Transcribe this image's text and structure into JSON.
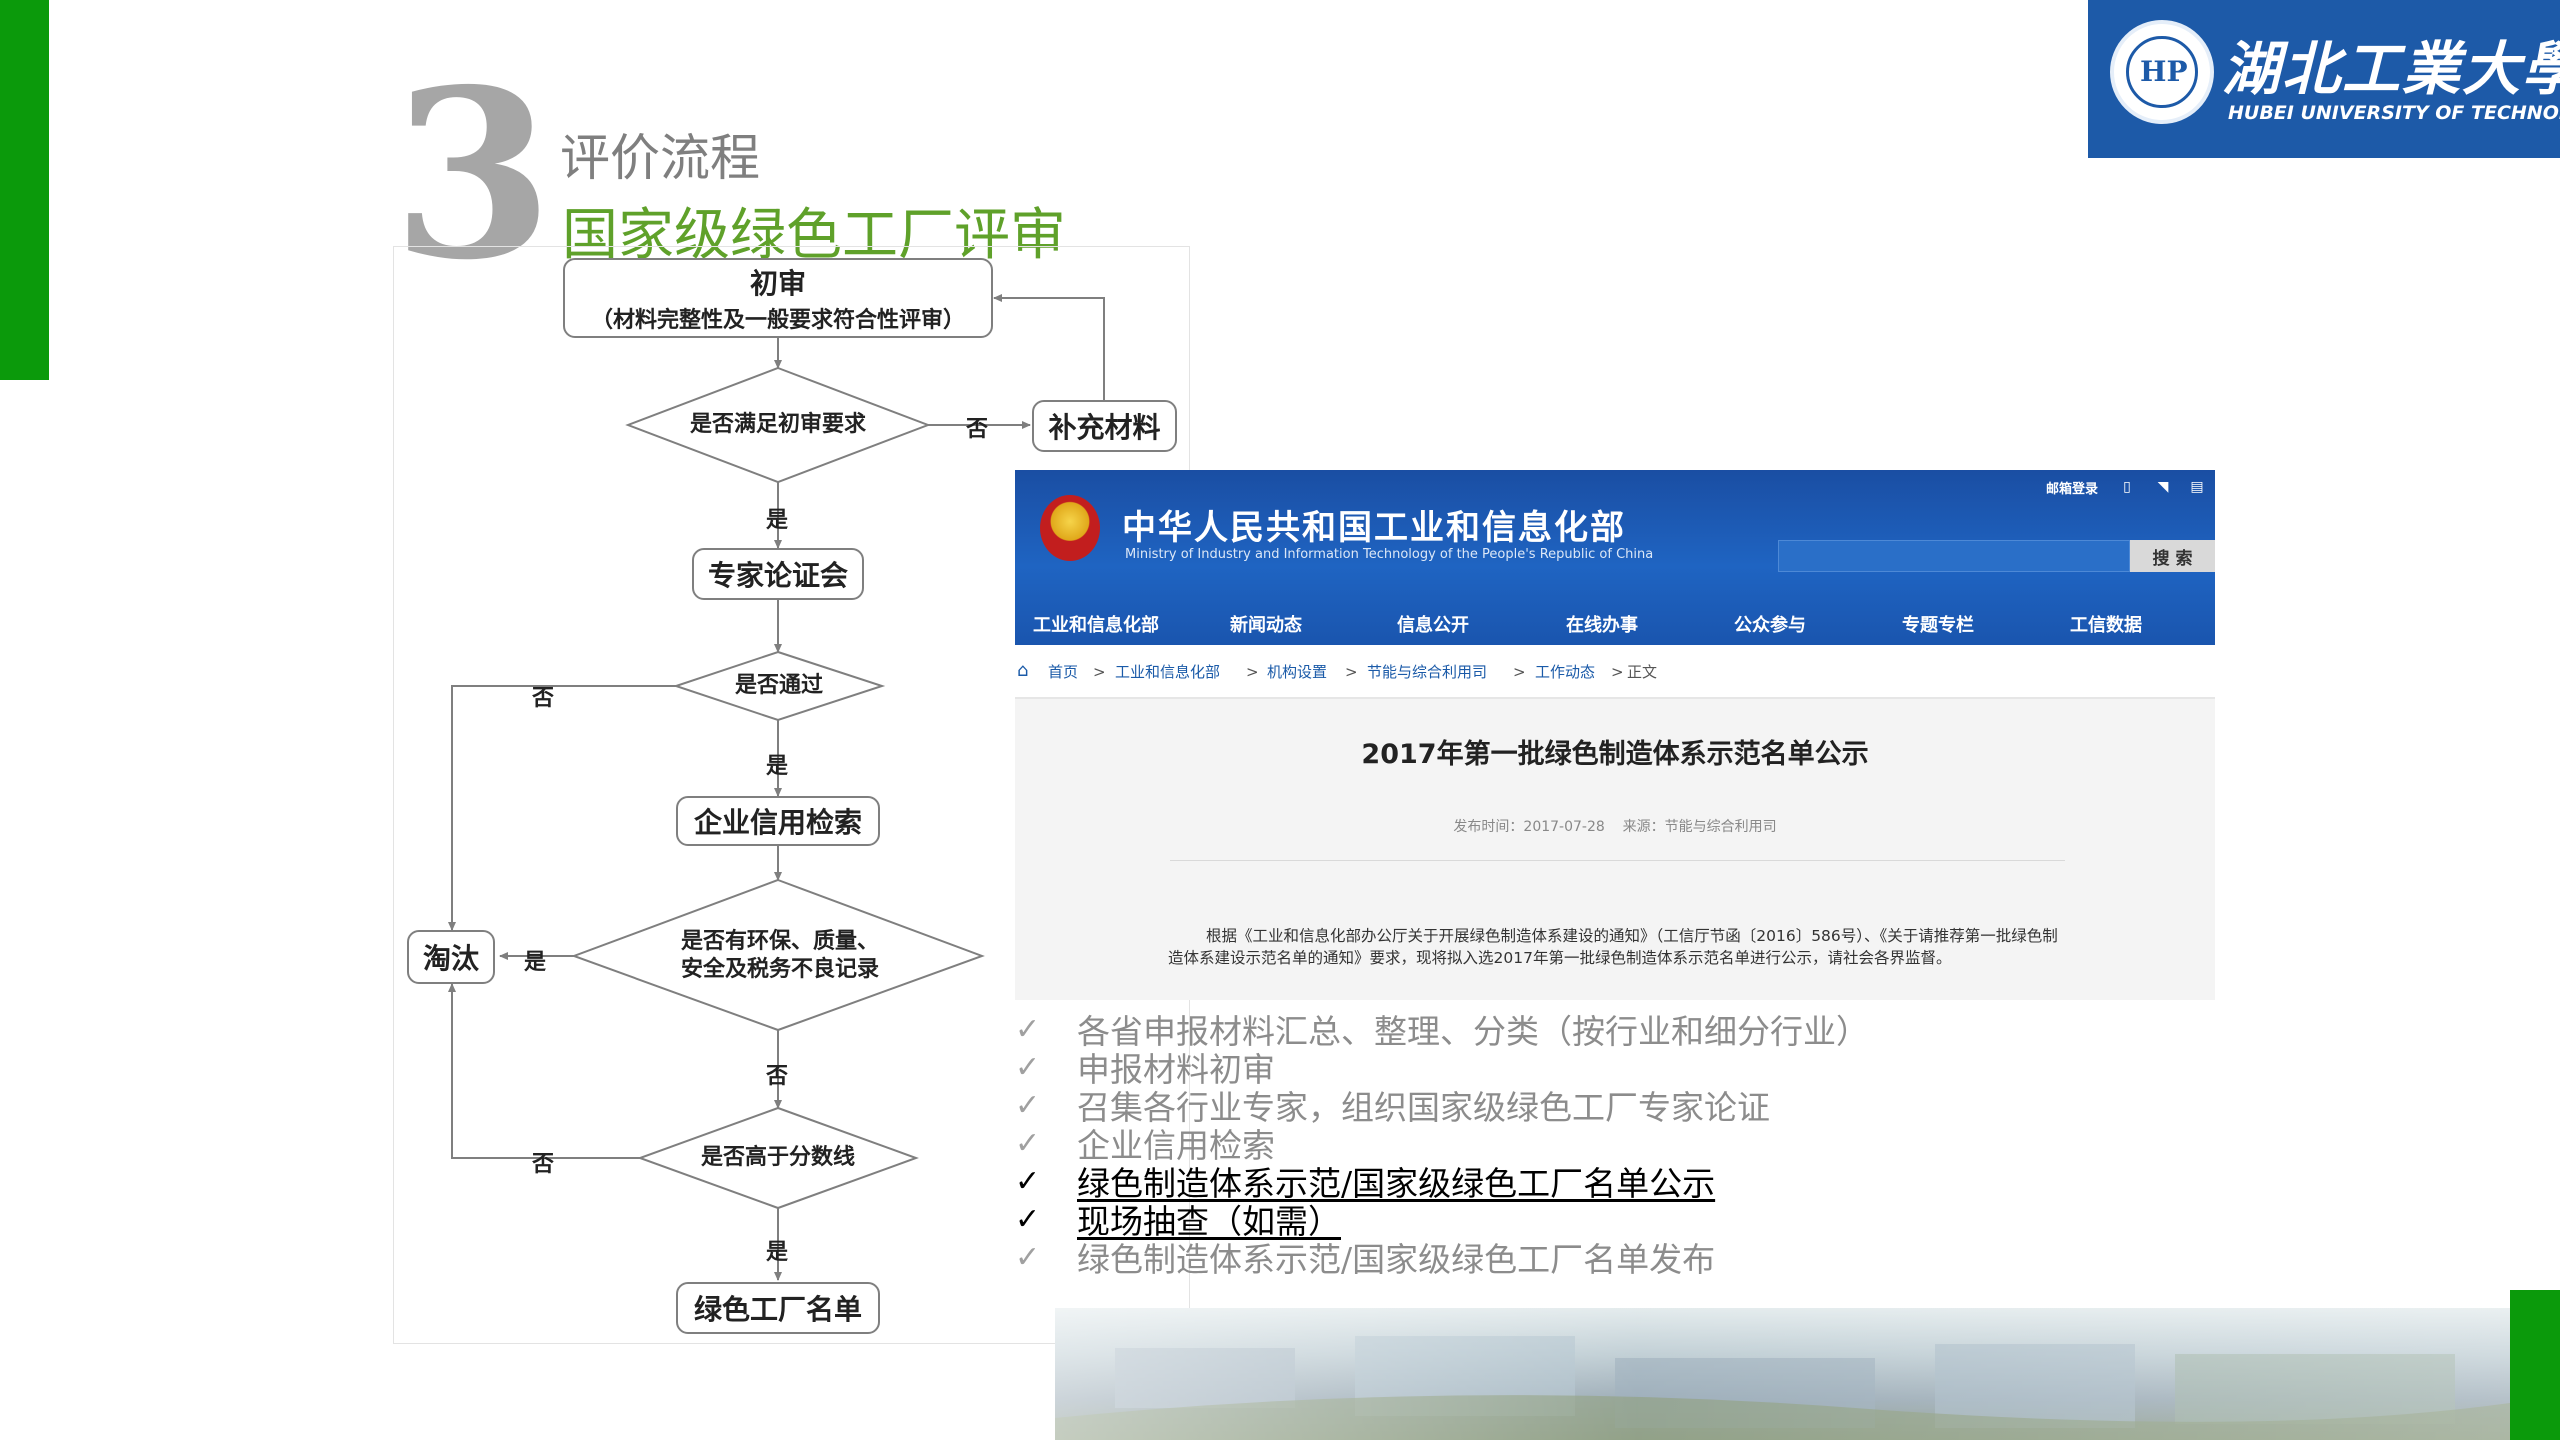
{
  "slide": {
    "number": "3",
    "title": "评价流程",
    "subtitle": "国家级绿色工厂评审"
  },
  "logo": {
    "name_cn": "湖北工業大學",
    "name_en": "HUBEI UNIVERSITY OF TECHNOLOGY",
    "seal_mark": "HP"
  },
  "flowchart": {
    "initial_review": "初审",
    "initial_review_detail": "（材料完整性及一般要求符合性评审）",
    "q_meets_initial": "是否满足初审要求",
    "supplement": "补充材料",
    "expert_meeting": "专家论证会",
    "q_passed": "是否通过",
    "credit_check": "企业信用检索",
    "q_bad_record_line1": "是否有环保、质量、",
    "q_bad_record_line2": "安全及税务不良记录",
    "eliminate": "淘汰",
    "q_above_cutoff": "是否高于分数线",
    "green_list": "绿色工厂名单",
    "label_yes": "是",
    "label_no": "否"
  },
  "website": {
    "ministry_cn": "中华人民共和国工业和信息化部",
    "ministry_en": "Ministry of Industry and Information Technology of the People's Republic of China",
    "mail_login": "邮箱登录",
    "icons": [
      "mobile-icon",
      "rss-icon",
      "sitemap-icon"
    ],
    "search_button": "搜 索",
    "nav": [
      "工业和信息化部",
      "新闻动态",
      "信息公开",
      "在线办事",
      "公众参与",
      "专题专栏",
      "工信数据"
    ],
    "breadcrumb": [
      "首页",
      "工业和信息化部",
      "机构设置",
      "节能与综合利用司",
      "工作动态",
      "正文"
    ],
    "crumb_sep": ">",
    "article_title": "2017年第一批绿色制造体系示范名单公示",
    "publish_time": "发布时间：2017-07-28",
    "source": "来源：节能与综合利用司",
    "body": "根据《工业和信息化部办公厅关于开展绿色制造体系建设的通知》（工信厅节函〔2016〕586号）、《关于请推荐第一批绿色制造体系建设示范名单的通知》要求，现将拟入选2017年第一批绿色制造体系示范名单进行公示，请社会各界监督。"
  },
  "checklist": {
    "mark": "✓",
    "items": [
      {
        "text": "各省申报材料汇总、整理、分类（按行业和细分行业）",
        "emphasis": false
      },
      {
        "text": "申报材料初审",
        "emphasis": false
      },
      {
        "text": "召集各行业专家，组织国家级绿色工厂专家论证",
        "emphasis": false
      },
      {
        "text": "企业信用检索",
        "emphasis": false
      },
      {
        "text": "绿色制造体系示范/国家级绿色工厂名单公示",
        "emphasis": true
      },
      {
        "text": "现场抽查（如需）",
        "emphasis": true
      },
      {
        "text": "绿色制造体系示范/国家级绿色工厂名单发布",
        "emphasis": false
      }
    ]
  },
  "colors": {
    "accent_green": "#0b9a0b",
    "subtitle_green": "#5fa12a",
    "logo_blue": "#1d5aa8",
    "header_blue": "#1f64c2"
  }
}
